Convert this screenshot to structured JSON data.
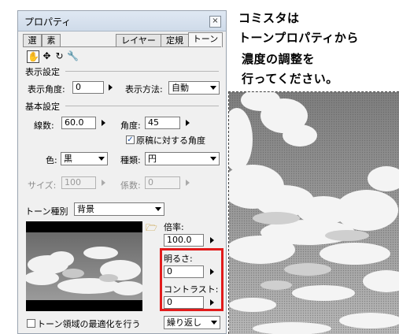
{
  "panel": {
    "title": "プロパティ",
    "close_icon": "close-icon",
    "tabs": [
      "選",
      "素",
      "レイヤー",
      "定規",
      "トーン"
    ],
    "active_tab": "トーン",
    "tools": [
      "hand-icon",
      "move-icon",
      "rotate-icon",
      "wrench-icon"
    ],
    "display_section": "表示設定",
    "display_angle_label": "表示角度:",
    "display_angle_value": "0",
    "display_method_label": "表示方法:",
    "display_method_value": "自動",
    "basic_section": "基本設定",
    "lines_label": "線数:",
    "lines_value": "60.0",
    "angle_label": "角度:",
    "angle_value": "45",
    "relative_angle_label": "原稿に対する角度",
    "relative_angle_checked": true,
    "color_label": "色:",
    "color_value": "黒",
    "kind_label": "種類:",
    "kind_value": "円",
    "size_label": "サイズ:",
    "size_value": "100",
    "coef_label": "係数:",
    "coef_value": "0",
    "tone_kind_label": "トーン種別",
    "tone_kind_value": "背景",
    "folder_icon": "folder-icon",
    "scale_label": "倍率:",
    "scale_value": "100.0",
    "brightness_label": "明るさ:",
    "brightness_value": "0",
    "contrast_label": "コントラスト:",
    "contrast_value": "0",
    "optimize_label": "トーン領域の最適化を行う",
    "optimize_checked": false,
    "repeat_value": "繰り返し"
  },
  "annotation": {
    "line1": "コミスタは",
    "line2": "トーンプロパティから",
    "line3": "濃度の調整を",
    "line4": "行ってください。"
  },
  "colors": {
    "highlight": "#e11b1b",
    "panel_bg": "#f0f0f0"
  }
}
